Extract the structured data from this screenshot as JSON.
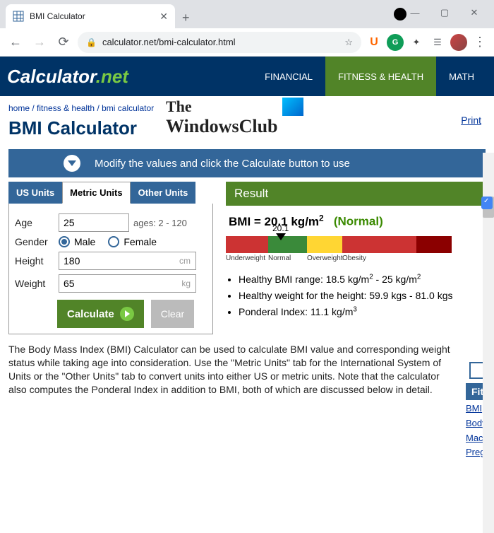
{
  "browser": {
    "tab_title": "BMI Calculator",
    "url": "calculator.net/bmi-calculator.html"
  },
  "header": {
    "logo_main": "Calculator",
    "logo_net": ".net",
    "nav": {
      "financial": "FINANCIAL",
      "fitness": "FITNESS & HEALTH",
      "math": "MATH"
    }
  },
  "breadcrumb": {
    "home": "home",
    "sep": " / ",
    "fitness": "fitness & health",
    "page": "bmi calculator"
  },
  "page_title": "BMI Calculator",
  "print": "Print",
  "watermark": {
    "line1": "The",
    "line2": "WindowsClub"
  },
  "banner": "Modify the values and click the Calculate button to use",
  "tabs": {
    "us": "US Units",
    "metric": "Metric Units",
    "other": "Other Units"
  },
  "form": {
    "age_label": "Age",
    "age_value": "25",
    "age_hint": "ages: 2 - 120",
    "gender_label": "Gender",
    "male": "Male",
    "female": "Female",
    "height_label": "Height",
    "height_value": "180",
    "height_unit": "cm",
    "weight_label": "Weight",
    "weight_value": "65",
    "weight_unit": "kg",
    "calculate": "Calculate",
    "clear": "Clear"
  },
  "result": {
    "header": "Result",
    "label": "BMI = ",
    "value": "20.1 kg/m",
    "exp": "2",
    "status": "(Normal)",
    "pointer": "20.1",
    "scale": {
      "under": "Underweight",
      "normal": "Normal",
      "over": "Overweight",
      "obesity": "Obesity"
    },
    "bullets": {
      "b1a": "Healthy BMI range: 18.5 kg/m",
      "b1b": " - 25 kg/m",
      "b2": "Healthy weight for the height: 59.9 kgs - 81.0 kgs",
      "b3a": "Ponderal Index: 11.1 kg/m"
    }
  },
  "sidebar": {
    "title": "Fitn",
    "l1": "BMI",
    "l2": "Body",
    "l3": "Macr",
    "l4": "Preg"
  },
  "body_text": "The Body Mass Index (BMI) Calculator can be used to calculate BMI value and corresponding weight status while taking age into consideration. Use the \"Metric Units\" tab for the International System of Units or the \"Other Units\" tab to convert units into either US or metric units. Note that the calculator also computes the Ponderal Index in addition to BMI, both of which are discussed below in detail."
}
